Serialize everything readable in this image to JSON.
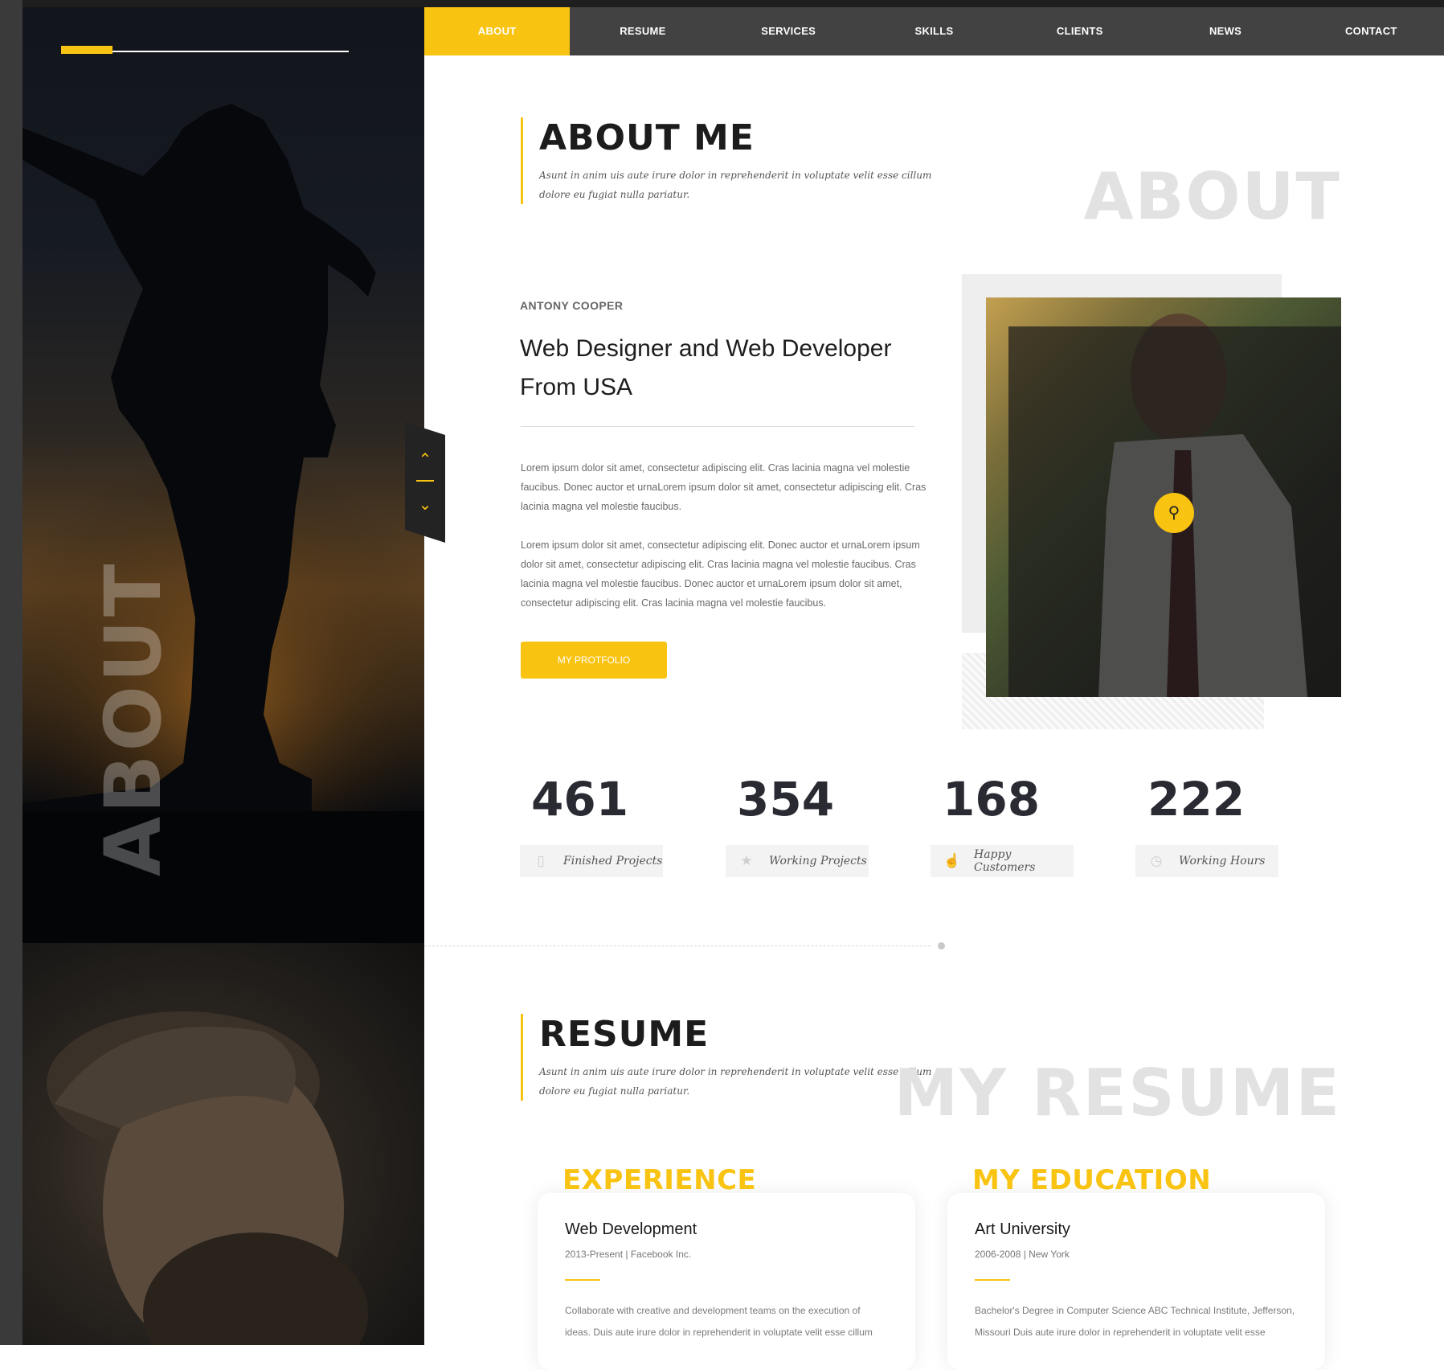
{
  "nav": {
    "items": [
      "ABOUT",
      "RESUME",
      "SERVICES",
      "SKILLS",
      "CLIENTS",
      "NEWS",
      "CONTACT"
    ]
  },
  "hero": {
    "vertical_text": "ABOUT"
  },
  "about": {
    "title": "ABOUT ME",
    "subtitle": "Asunt in anim uis aute irure dolor in reprehenderit in voluptate velit esse cillum dolore eu fugiat nulla pariatur.",
    "watermark": "ABOUT",
    "name": "ANTONY COOPER",
    "role": "Web Designer and Web Developer From USA",
    "para1": "Lorem ipsum dolor sit amet, consectetur adipiscing elit. Cras lacinia magna vel molestie faucibus. Donec auctor et urnaLorem ipsum dolor sit amet, consectetur adipiscing elit. Cras lacinia magna vel molestie faucibus.",
    "para2": "Lorem ipsum dolor sit amet, consectetur adipiscing elit. Donec auctor et urnaLorem ipsum dolor sit amet, consectetur adipiscing elit. Cras lacinia magna vel molestie faucibus. Cras lacinia magna vel molestie faucibus. Donec auctor et urnaLorem ipsum dolor sit amet, consectetur adipiscing elit. Cras lacinia magna vel molestie faucibus.",
    "button": "MY PROTFOLIO"
  },
  "stats": [
    {
      "value": "461",
      "label": "Finished Projects",
      "icon": "folder-icon"
    },
    {
      "value": "354",
      "label": "Working Projects",
      "icon": "trophy-icon"
    },
    {
      "value": "168",
      "label": "Happy Customers",
      "icon": "thumbs-up-icon"
    },
    {
      "value": "222",
      "label": "Working Hours",
      "icon": "clock-icon"
    }
  ],
  "resume": {
    "title": "RESUME",
    "subtitle": "Asunt in anim uis aute irure dolor in reprehenderit in voluptate velit esse cillum dolore eu fugiat nulla pariatur.",
    "watermark": "MY RESUME",
    "experience": {
      "heading": "EXPERIENCE",
      "title": "Web Development",
      "meta": "2013-Present | Facebook Inc.",
      "body": "Collaborate with creative and development teams on the execution of ideas.  Duis aute irure dolor in reprehenderit in voluptate velit esse cillum"
    },
    "education": {
      "heading": "MY EDUCATION",
      "title": "Art University",
      "meta": "2006-2008 | New York",
      "body": "Bachelor's Degree in Computer Science ABC Technical Institute, Jefferson, Missouri Duis aute irure dolor in reprehenderit in voluptate velit esse"
    }
  },
  "colors": {
    "accent": "#f9c311",
    "nav_bg": "#424242"
  }
}
